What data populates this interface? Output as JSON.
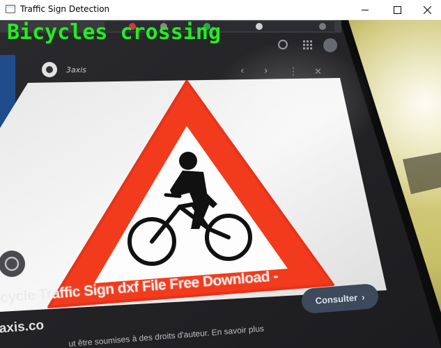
{
  "window": {
    "title": "Traffic Sign Detection",
    "controls": {
      "minimize_icon": "minimize-icon",
      "maximize_icon": "maximize-icon",
      "close_icon": "close-icon"
    }
  },
  "detection": {
    "label": "Bicycles crossing",
    "label_color": "#22ee22"
  },
  "camera_view": {
    "card_source": "3axis",
    "card_title": "icycle Traffic Sign dxf File Free Download -",
    "card_site": "axis.co",
    "card_subtitle": "ut être soumises à des droits d'auteur. En savoir plus",
    "consult_button": "Consulter",
    "consult_chevron": "›",
    "sign": {
      "shape": "warning-triangle",
      "symbol": "bicycle-with-rider",
      "border_color": "#f23b1c",
      "fill_color": "#ffffff"
    }
  }
}
